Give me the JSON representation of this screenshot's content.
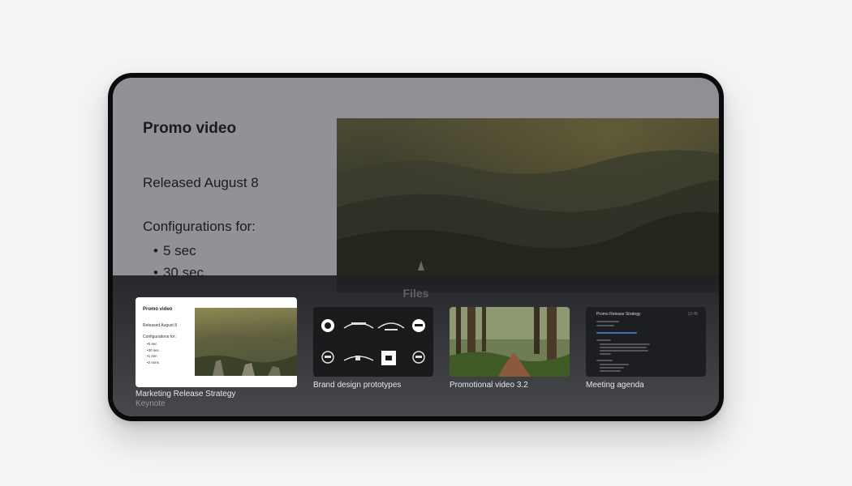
{
  "document": {
    "title": "Promo video",
    "released": "Released August 8",
    "configurations_heading": "Configurations for:",
    "configurations": [
      "5 sec",
      "30 sec"
    ]
  },
  "switcher": {
    "heading": "Files",
    "cards": [
      {
        "name": "Marketing Release Strategy",
        "app": "Keynote",
        "thumb": {
          "title": "Promo video",
          "released": "Released August 8",
          "configurations_heading": "Configurations for:",
          "configurations": [
            "5 sec",
            "30 sec",
            "1 min",
            "2 mins"
          ]
        }
      },
      {
        "name": "Brand design prototypes"
      },
      {
        "name": "Promotional video 3.2"
      },
      {
        "name": "Meeting agenda",
        "thumb": {
          "title": "Promo Release Strategy",
          "time": "12:45"
        }
      }
    ]
  },
  "colors": {
    "device_frame": "#0b0b0c",
    "doc_pane": "#919298",
    "switcher_bg": "#37383c",
    "agenda_link": "#4a6fb0"
  }
}
